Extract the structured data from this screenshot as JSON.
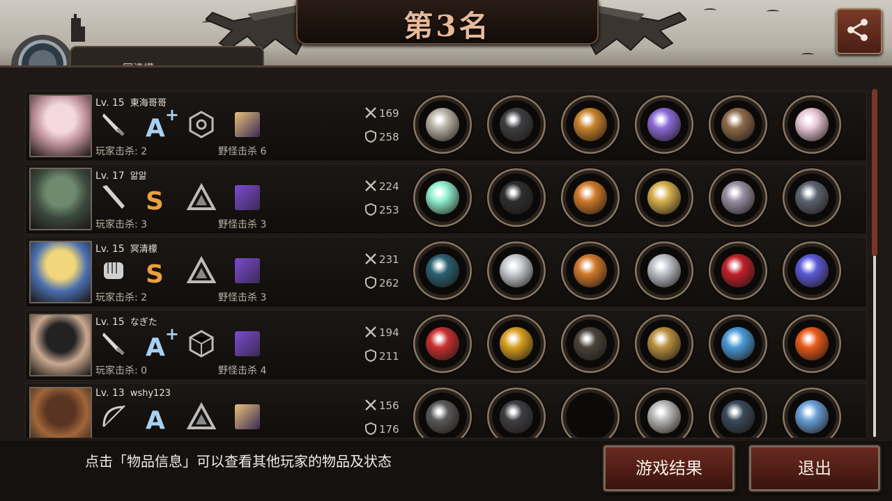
{
  "header": {
    "title": "第3名",
    "tab_text": "冥清檬"
  },
  "hint": "点击「物品信息」可以查看其他玩家的物品及状态",
  "buttons": {
    "result": "游戏结果",
    "exit": "退出"
  },
  "labels": {
    "player_kills": "玩家击杀:",
    "monster_kills": "野怪击杀"
  },
  "players": [
    {
      "level": "Lv. 15",
      "name": "東海哥哥",
      "grade": "A",
      "grade_plus": "+",
      "weapon_icon": "knife-icon",
      "skill_icon": "hex-node-icon",
      "badge_color": "#e8c07a",
      "player_kills": "2",
      "monster_kills": "6",
      "atk": "169",
      "def": "258",
      "portrait": [
        "#f3d9dd",
        "#b98c96"
      ],
      "items": [
        "#b9b3a6",
        "#3e3e42",
        "#c8832c",
        "#8c6ad8",
        "#8d6a4a",
        "#e8c8d8"
      ]
    },
    {
      "level": "Lv. 17",
      "name": "앎앎",
      "grade": "S",
      "grade_plus": "",
      "weapon_icon": "bat-icon",
      "skill_icon": "triangle-rune-icon",
      "badge_color": "#7c4cd0",
      "player_kills": "3",
      "monster_kills": "3",
      "atk": "224",
      "def": "253",
      "portrait": [
        "#6f8a6e",
        "#3b4a3d"
      ],
      "items": [
        "#8ff0d0",
        "#2e2e30",
        "#d07a2a",
        "#d6b04c",
        "#9a8ea2",
        "#5c6470"
      ]
    },
    {
      "level": "Lv. 15",
      "name": "冥清檬",
      "grade": "S",
      "grade_plus": "",
      "weapon_icon": "fist-icon",
      "skill_icon": "triangle-rune-icon",
      "badge_color": "#7c4cd0",
      "player_kills": "2",
      "monster_kills": "3",
      "atk": "231",
      "def": "262",
      "portrait": [
        "#f1d67a",
        "#4a6fb0"
      ],
      "items": [
        "#2a6070",
        "#c8ccd0",
        "#d07a2a",
        "#bcc0c8",
        "#c0202a",
        "#5a5ad8"
      ]
    },
    {
      "level": "Lv. 15",
      "name": "なぎた",
      "grade": "A",
      "grade_plus": "+",
      "weapon_icon": "knife-icon",
      "skill_icon": "cube-rune-icon",
      "badge_color": "#7c4cd0",
      "player_kills": "0",
      "monster_kills": "4",
      "atk": "194",
      "def": "211",
      "portrait": [
        "#222222",
        "#c9a890"
      ],
      "items": [
        "#c83030",
        "#d8a020",
        "#4a423a",
        "#b89040",
        "#4a9ad8",
        "#e85a1a"
      ]
    },
    {
      "level": "Lv. 13",
      "name": "wshy123",
      "grade": "A",
      "grade_plus": "",
      "weapon_icon": "bow-icon",
      "skill_icon": "triangle-rune-icon",
      "badge_color": "#e8c07a",
      "player_kills": "",
      "monster_kills": "",
      "atk": "156",
      "def": "176",
      "portrait": [
        "#5a3422",
        "#a0663a"
      ],
      "items": [
        "#5a5a5a",
        "#3e3e42",
        "#000000",
        "#b8b8b8",
        "#3a4a5a",
        "#6aa0d8"
      ]
    }
  ],
  "colors": {
    "grade_a": "#a8d0f0",
    "grade_s": "#e8a040",
    "accent": "#7a3528"
  }
}
